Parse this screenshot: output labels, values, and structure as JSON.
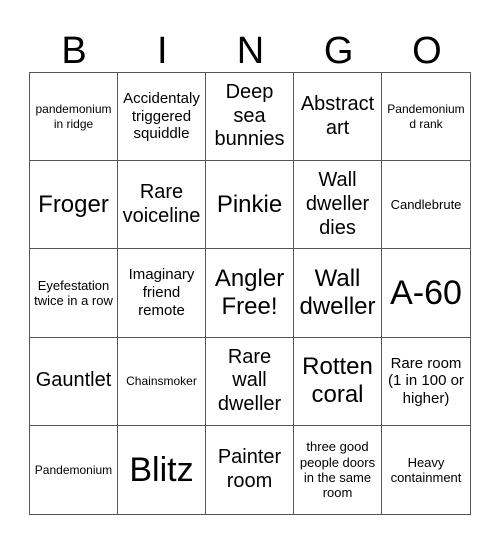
{
  "header": {
    "letters": [
      "B",
      "I",
      "N",
      "G",
      "O"
    ]
  },
  "cells": [
    [
      "pandemonium in ridge",
      "Accidentaly triggered squiddle",
      "Deep sea bunnies",
      "Abstract art",
      "Pandemonium d rank"
    ],
    [
      "Froger",
      "Rare voiceline",
      "Pinkie",
      "Wall dweller dies",
      "Candlebrute"
    ],
    [
      "Eyefestation twice in a row",
      "Imaginary friend remote",
      "Angler Free!",
      "Wall dweller",
      "A-60"
    ],
    [
      "Gauntlet",
      "Chainsmoker",
      "Rare wall dweller",
      "Rotten coral",
      "Rare room (1 in 100 or higher)"
    ],
    [
      "Pandemonium",
      "Blitz",
      "Painter room",
      "three good people doors in the same room",
      "Heavy containment"
    ]
  ]
}
